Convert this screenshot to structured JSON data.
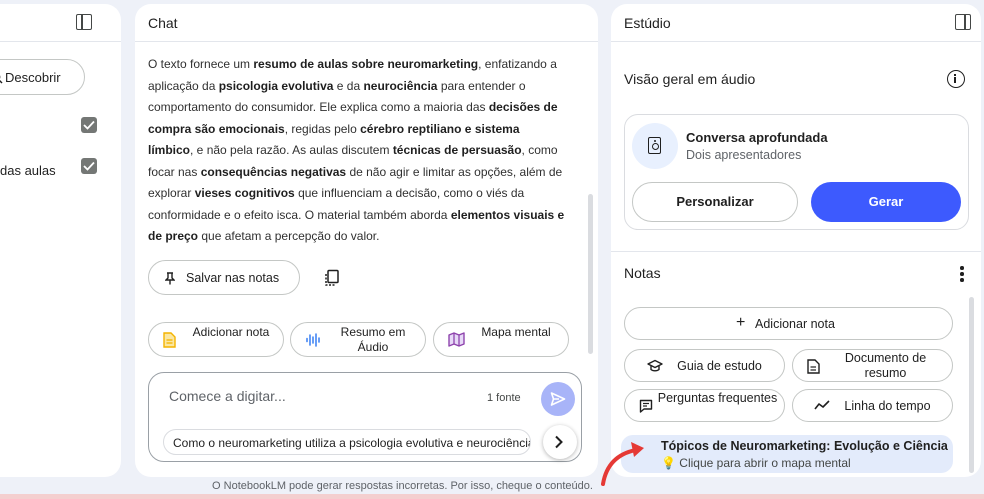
{
  "sources": {
    "discover_label": "Descobrir",
    "item_label": "das aulas"
  },
  "chat": {
    "title": "Chat",
    "paragraph": [
      {
        "t": "O texto fornece um ",
        "b": false
      },
      {
        "t": "resumo de aulas sobre neuromarketing",
        "b": true
      },
      {
        "t": ", enfatizando a aplicação da ",
        "b": false
      },
      {
        "t": "psicologia evolutiva",
        "b": true
      },
      {
        "t": " e da ",
        "b": false
      },
      {
        "t": "neurociência",
        "b": true
      },
      {
        "t": " para entender o comportamento do consumidor. Ele explica como a maioria das ",
        "b": false
      },
      {
        "t": "decisões de compra são emocionais",
        "b": true
      },
      {
        "t": ", regidas pelo ",
        "b": false
      },
      {
        "t": "cérebro reptiliano e sistema límbico",
        "b": true
      },
      {
        "t": ", e não pela razão. As aulas discutem ",
        "b": false
      },
      {
        "t": "técnicas de persuasão",
        "b": true
      },
      {
        "t": ", como focar nas ",
        "b": false
      },
      {
        "t": "consequências negativas",
        "b": true
      },
      {
        "t": " de não agir e limitar as opções, além de explorar ",
        "b": false
      },
      {
        "t": "vieses cognitivos",
        "b": true
      },
      {
        "t": " que influenciam a decisão, como o viés da conformidade e o efeito isca. O material também aborda ",
        "b": false
      },
      {
        "t": "elementos visuais e de preço",
        "b": true
      },
      {
        "t": " que afetam a percepção do valor.",
        "b": false
      }
    ],
    "save_notes_label": "Salvar nas notas",
    "actions": {
      "add_note": "Adicionar nota",
      "audio_summary": "Resumo em Áudio",
      "mind_map": "Mapa mental"
    },
    "composer": {
      "placeholder": "Comece a digitar...",
      "source_count": "1 fonte",
      "suggestion": "Como o neuromarketing utiliza a psicologia evolutiva e neurociência"
    }
  },
  "studio": {
    "title": "Estúdio",
    "audio_overview_title": "Visão geral em áudio",
    "audio_card": {
      "title": "Conversa aprofundada",
      "subtitle": "Dois apresentadores",
      "customize_label": "Personalizar",
      "generate_label": "Gerar"
    },
    "notes_title": "Notas",
    "add_note_label": "Adicionar nota",
    "note_actions": {
      "study_guide": "Guia de estudo",
      "summary_doc": "Documento de resumo",
      "faq": "Perguntas frequentes",
      "timeline": "Linha do tempo"
    },
    "topic": {
      "title": "Tópicos de Neuromarketing: Evolução e Ciência",
      "subtitle": "Clique para abrir o mapa mental",
      "emoji": "💡"
    }
  },
  "footer_note": "O NotebookLM pode gerar respostas incorretas. Por isso, cheque o conteúdo.",
  "colors": {
    "accent": "#3d5afe",
    "send_button": "#a8b4f8",
    "highlight_arrow": "#e53935",
    "topic_bg": "#e3ebfb"
  }
}
